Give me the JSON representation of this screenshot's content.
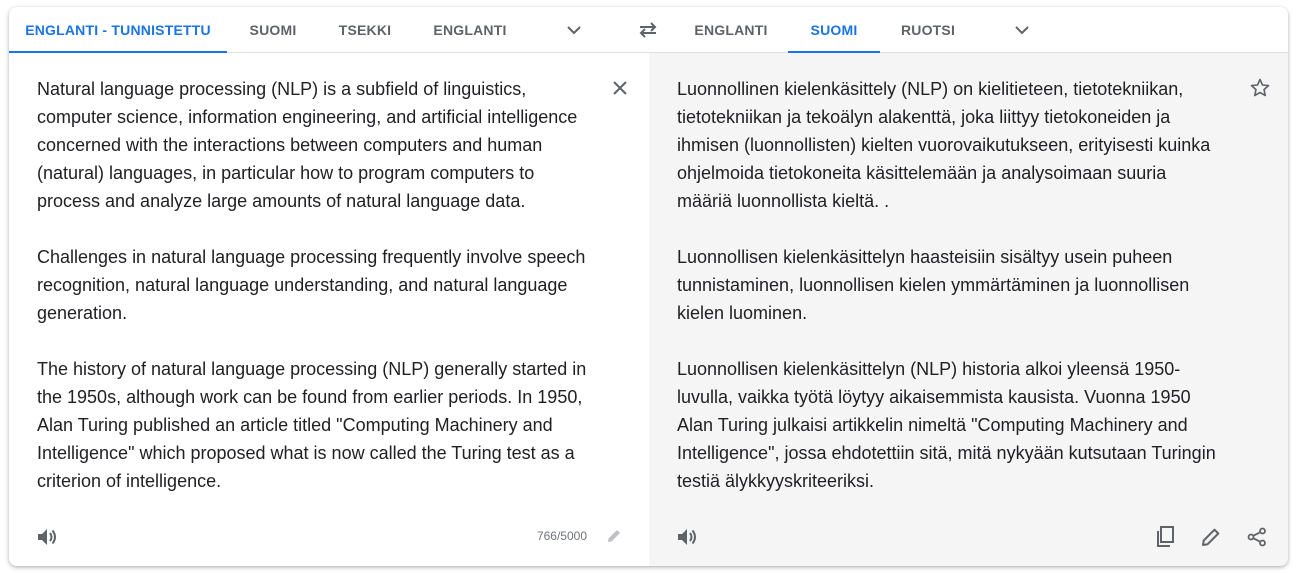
{
  "source_tabs": [
    {
      "label": "ENGLANTI - TUNNISTETTU",
      "active": true
    },
    {
      "label": "SUOMI",
      "active": false
    },
    {
      "label": "TSEKKI",
      "active": false
    },
    {
      "label": "ENGLANTI",
      "active": false
    }
  ],
  "target_tabs": [
    {
      "label": "ENGLANTI",
      "active": false
    },
    {
      "label": "SUOMI",
      "active": true
    },
    {
      "label": "RUOTSI",
      "active": false
    }
  ],
  "icons": {
    "source_more": "chevron-down-icon",
    "swap": "swap-arrows-icon",
    "target_more": "chevron-down-icon",
    "clear": "close-icon",
    "star": "star-outline-icon",
    "speaker": "speaker-icon",
    "edit": "pencil-icon",
    "copy": "copy-icon",
    "share": "share-icon"
  },
  "colors": {
    "accent": "#1a73e8",
    "target_background": "#f5f5f5",
    "icon": "#5f6368"
  },
  "source": {
    "text": "Natural language processing (NLP) is a subfield of linguistics,\ncomputer science, information engineering, and artificial intelligence\nconcerned with the interactions between computers and human\n(natural) languages, in particular how to program computers to\nprocess and analyze large amounts of natural language data.\n\nChallenges in natural language processing frequently involve speech\nrecognition, natural language understanding, and natural language\ngeneration.\n\nThe history of natural language processing (NLP) generally started in\nthe 1950s, although work can be found from earlier periods. In 1950,\nAlan Turing published an article titled \"Computing Machinery and\nIntelligence\" which proposed what is now called the Turing test as a\ncriterion of intelligence.",
    "char_count": "766/5000"
  },
  "target": {
    "text": "Luonnollinen kielenkäsittely (NLP) on kielitieteen, tietotekniikan,\ntietotekniikan ja tekoälyn alakenttä, joka liittyy tietokoneiden ja\nihmisen (luonnollisten) kielten vuorovaikutukseen, erityisesti kuinka\nohjelmoida tietokoneita käsittelemään ja analysoimaan suuria\nmääriä luonnollista kieltä. .\n\nLuonnollisen kielenkäsittelyn haasteisiin sisältyy usein puheen\ntunnistaminen, luonnollisen kielen ymmärtäminen ja luonnollisen\nkielen luominen.\n\nLuonnollisen kielenkäsittelyn (NLP) historia alkoi yleensä 1950-\nluvulla, vaikka työtä löytyy aikaisemmista kausista. Vuonna 1950\nAlan Turing julkaisi artikkelin nimeltä \"Computing Machinery and\nIntelligence\", jossa ehdotettiin sitä, mitä nykyään kutsutaan Turingin\ntestiä älykkyyskriteeriksi."
  }
}
